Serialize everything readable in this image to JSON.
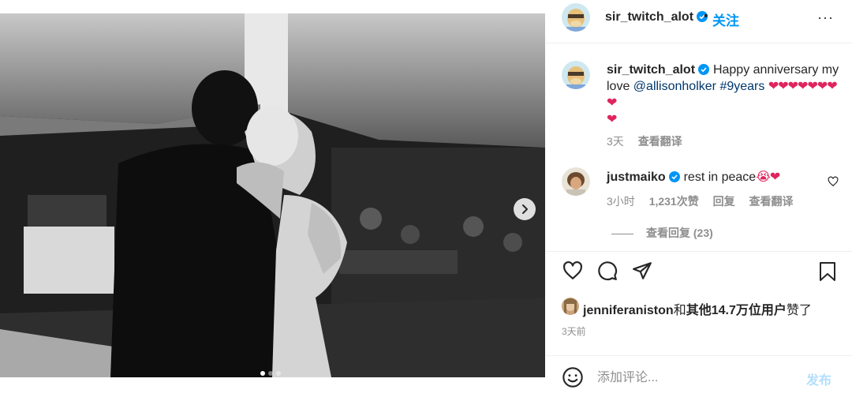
{
  "post": {
    "photo_alt": "",
    "carousel": {
      "dot_count": 3,
      "active_index": 0
    }
  },
  "header": {
    "username": "sir_twitch_alot",
    "separator": "•",
    "follow_label": "关注",
    "more_label": "···"
  },
  "caption": {
    "username": "sir_twitch_alot",
    "text_1": "Happy anniversary my love ",
    "mention": "@allisonholker",
    "hashtag": "#9years",
    "hearts": "❤❤❤❤❤❤❤❤",
    "hearts_line2": "❤",
    "time": "3天",
    "translate": "查看翻译"
  },
  "comment": {
    "username": "justmaiko",
    "text": "rest in peace",
    "emoji": "😭❤",
    "time": "3小时",
    "likes": "1,231次赞",
    "reply": "回复",
    "translate": "查看翻译",
    "view_replies": "查看回复 (23)"
  },
  "likes": {
    "first_user": "jenniferaniston",
    "connector": "和",
    "others": "其他14.7万位用户",
    "suffix": "赞了"
  },
  "post_time": "3天前",
  "comment_box": {
    "placeholder": "添加评论...",
    "post_label": "发布"
  },
  "colors": {
    "accent": "#0095f6",
    "link": "#00376b",
    "muted": "#8e8e8e",
    "heart": "#e0245e",
    "post_disabled": "#b2dffc"
  }
}
